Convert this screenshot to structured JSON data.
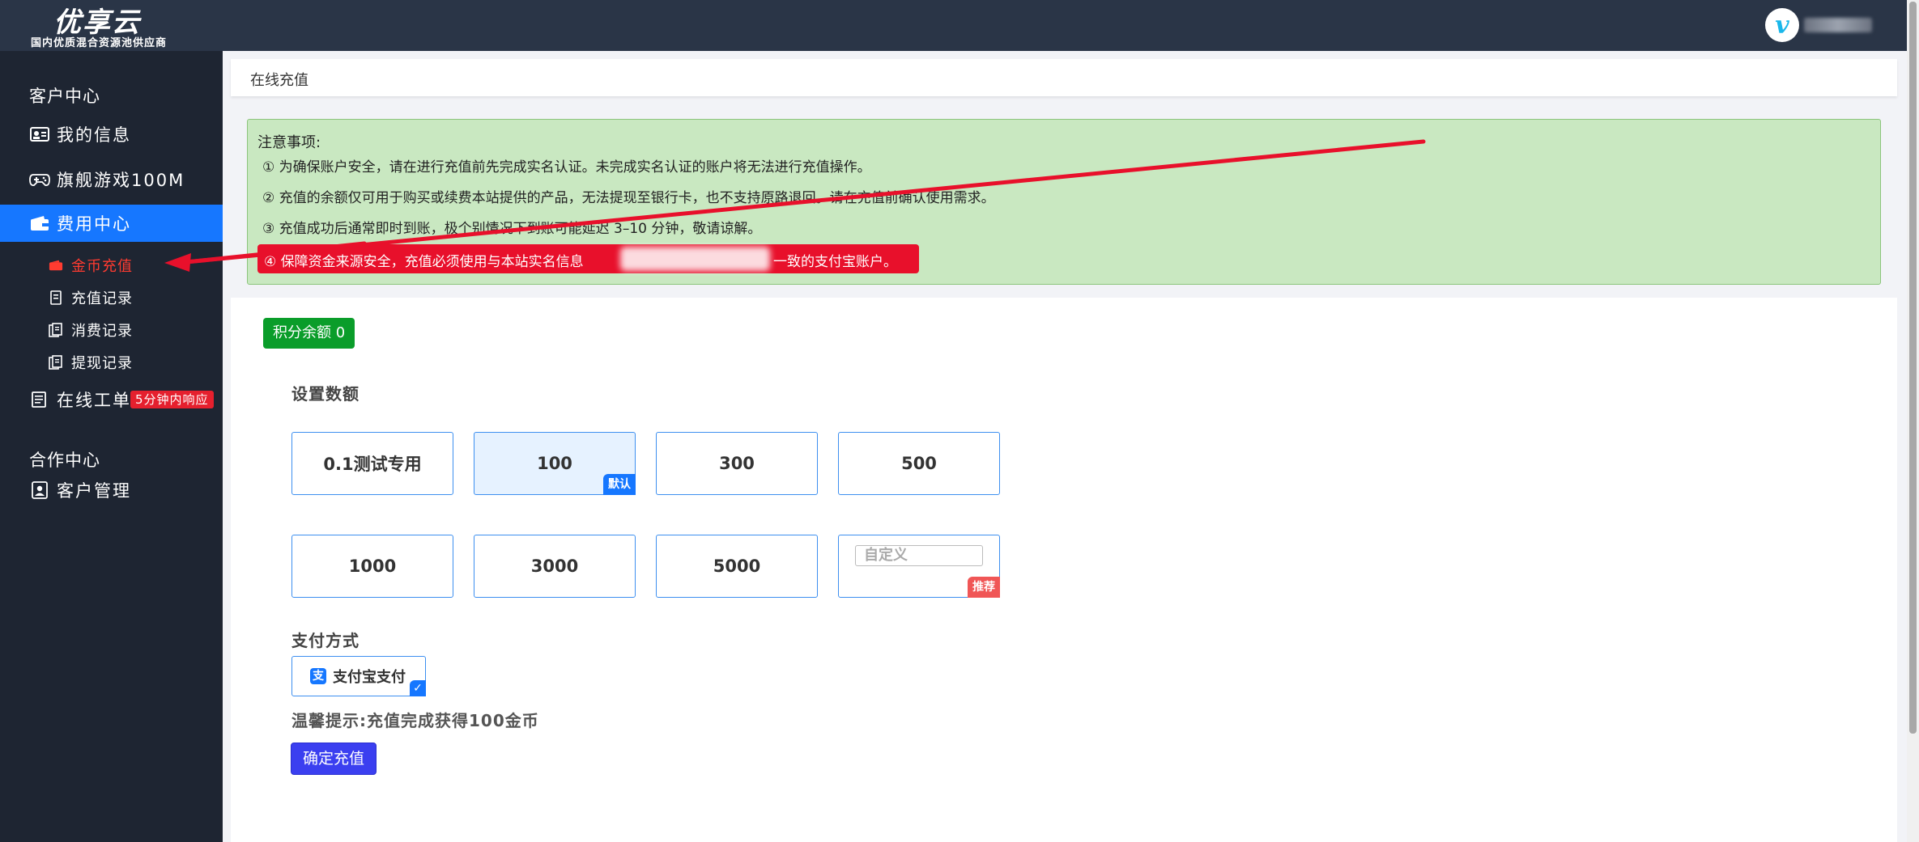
{
  "brand": {
    "title": "优享云",
    "subtitle": "国内优质混合资源池供应商"
  },
  "user": {
    "avatar_letter": "v"
  },
  "sidebar": {
    "section_customer": "客户中心",
    "my_info": "我的信息",
    "flagship_game": "旗舰游戏100M",
    "billing_center": "费用中心",
    "sub_items": [
      "金币充值",
      "充值记录",
      "消费记录",
      "提现记录"
    ],
    "ticket": "在线工单",
    "ticket_badge": "5分钟内响应",
    "section_partner": "合作中心",
    "client_mgmt": "客户管理"
  },
  "breadcrumb": {
    "title": "在线充值"
  },
  "notice": {
    "title": "注意事项:",
    "lines": [
      "① 为确保账户安全，请在进行充值前先完成实名认证。未完成实名认证的账户将无法进行充值操作。",
      "② 充值的余额仅可用于购买或续费本站提供的产品，无法提现至银行卡，也不支持原路退回。请在充值前确认使用需求。",
      "③ 充值成功后通常即时到账，极个别情况下到账可能延迟 3–10 分钟，敬请谅解。"
    ],
    "highlight_prefix": "④ 保障资金来源安全，充值必须使用与本站实名信息",
    "highlight_suffix": "一致的支付宝账户。"
  },
  "points_balance": "积分余额 0",
  "amount_section_label": "设置数额",
  "amounts": [
    "0.1测试专用",
    "100",
    "300",
    "500",
    "1000",
    "3000",
    "5000"
  ],
  "default_tag": "默认",
  "custom_placeholder": "自定义",
  "recommend_tag": "推荐",
  "payment_section_label": "支付方式",
  "payment_option": "支付宝支付",
  "alipay_icon_glyph": "支",
  "check_glyph": "✓",
  "tip": "温馨提示:充值完成获得100金币",
  "confirm_button": "确定充值",
  "colors": {
    "topbar": "#2a3547",
    "sidebar": "#1e2532",
    "active_blue": "#1677ff",
    "notice_bg": "#c9e8c1",
    "highlight_red": "#e8102b",
    "points_green": "#0a9d2a",
    "confirm_btn": "#3b3ff0"
  }
}
